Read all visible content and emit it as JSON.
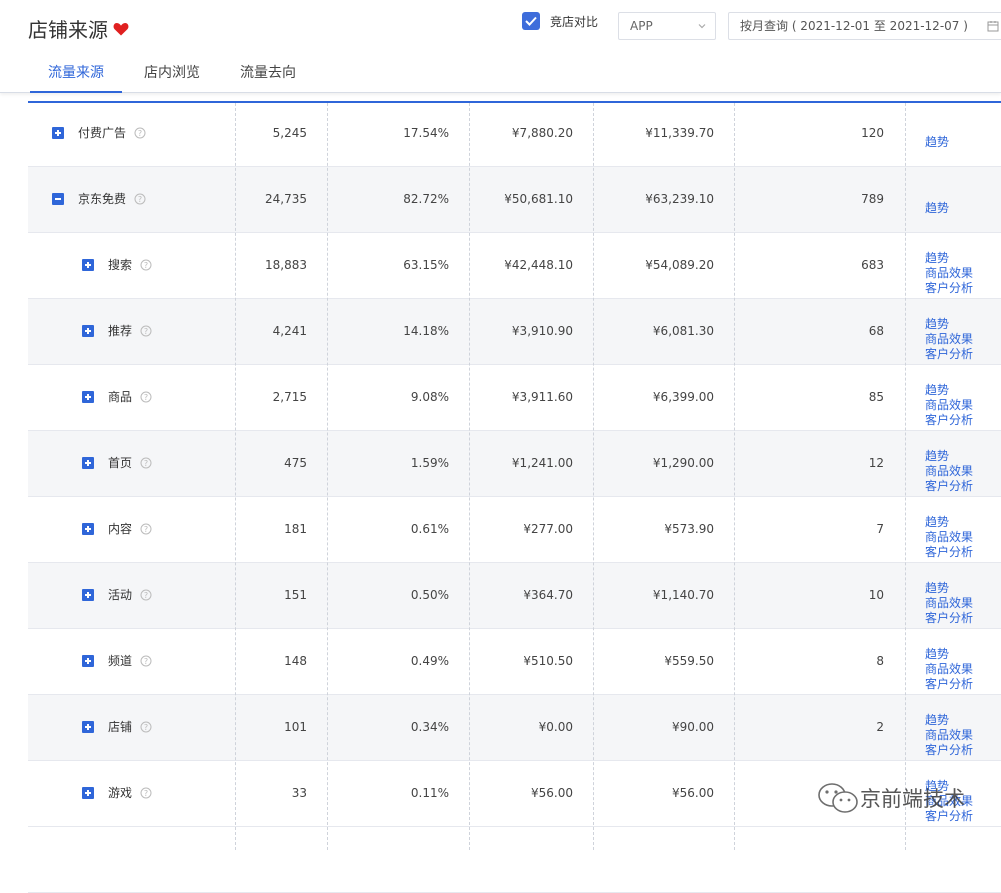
{
  "header": {
    "title": "店铺来源",
    "compare_label": "竞店对比",
    "platform": "APP",
    "date_range": "按月查询 ( 2021-12-01 至 2021-12-07 )",
    "tabs": [
      "流量来源",
      "店内浏览",
      "流量去向"
    ]
  },
  "rows": [
    {
      "name": "付费广告",
      "v1": "5,245",
      "v2": "17.54%",
      "v3": "¥7,880.20",
      "v4": "¥11,339.70",
      "v5": "120",
      "links": [
        "趋势"
      ],
      "level": 0,
      "expanded": false
    },
    {
      "name": "京东免费",
      "v1": "24,735",
      "v2": "82.72%",
      "v3": "¥50,681.10",
      "v4": "¥63,239.10",
      "v5": "789",
      "links": [
        "趋势"
      ],
      "level": 0,
      "expanded": true
    },
    {
      "name": "搜索",
      "v1": "18,883",
      "v2": "63.15%",
      "v3": "¥42,448.10",
      "v4": "¥54,089.20",
      "v5": "683",
      "links": [
        "趋势",
        "商品效果",
        "客户分析"
      ],
      "level": 1,
      "expanded": false
    },
    {
      "name": "推荐",
      "v1": "4,241",
      "v2": "14.18%",
      "v3": "¥3,910.90",
      "v4": "¥6,081.30",
      "v5": "68",
      "links": [
        "趋势",
        "商品效果",
        "客户分析"
      ],
      "level": 1,
      "expanded": false
    },
    {
      "name": "商品",
      "v1": "2,715",
      "v2": "9.08%",
      "v3": "¥3,911.60",
      "v4": "¥6,399.00",
      "v5": "85",
      "links": [
        "趋势",
        "商品效果",
        "客户分析"
      ],
      "level": 1,
      "expanded": false
    },
    {
      "name": "首页",
      "v1": "475",
      "v2": "1.59%",
      "v3": "¥1,241.00",
      "v4": "¥1,290.00",
      "v5": "12",
      "links": [
        "趋势",
        "商品效果",
        "客户分析"
      ],
      "level": 1,
      "expanded": false
    },
    {
      "name": "内容",
      "v1": "181",
      "v2": "0.61%",
      "v3": "¥277.00",
      "v4": "¥573.90",
      "v5": "7",
      "links": [
        "趋势",
        "商品效果",
        "客户分析"
      ],
      "level": 1,
      "expanded": false
    },
    {
      "name": "活动",
      "v1": "151",
      "v2": "0.50%",
      "v3": "¥364.70",
      "v4": "¥1,140.70",
      "v5": "10",
      "links": [
        "趋势",
        "商品效果",
        "客户分析"
      ],
      "level": 1,
      "expanded": false
    },
    {
      "name": "频道",
      "v1": "148",
      "v2": "0.49%",
      "v3": "¥510.50",
      "v4": "¥559.50",
      "v5": "8",
      "links": [
        "趋势",
        "商品效果",
        "客户分析"
      ],
      "level": 1,
      "expanded": false
    },
    {
      "name": "店铺",
      "v1": "101",
      "v2": "0.34%",
      "v3": "¥0.00",
      "v4": "¥90.00",
      "v5": "2",
      "links": [
        "趋势",
        "商品效果",
        "客户分析"
      ],
      "level": 1,
      "expanded": false
    },
    {
      "name": "游戏",
      "v1": "33",
      "v2": "0.11%",
      "v3": "¥56.00",
      "v4": "¥56.00",
      "v5": "",
      "links": [
        "趋势",
        "商品效果",
        "客户分析"
      ],
      "level": 1,
      "expanded": false
    }
  ],
  "watermark": "京前端技术",
  "colors": {
    "accent": "#2f66d9",
    "heart": "#e02020",
    "row_alt": "#f5f6f8"
  }
}
